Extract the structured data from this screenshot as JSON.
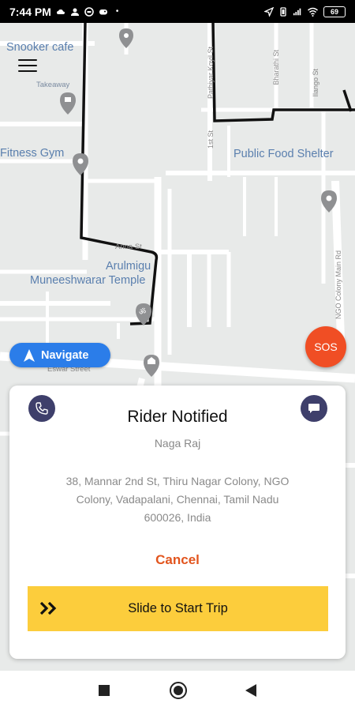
{
  "status_bar": {
    "time": "7:44 PM",
    "battery": "69",
    "icons": [
      "cloud-icon",
      "user-icon",
      "headset-icon",
      "dot"
    ],
    "right_icons": [
      "location-arrow-icon",
      "vibrate-icon",
      "signal-icon",
      "wifi-icon",
      "battery-icon"
    ]
  },
  "map": {
    "labels": {
      "snooker": "Snooker cafe",
      "takeaway": "Takeaway",
      "fitness": "Fitness Gym",
      "food_shelter": "Public Food Shelter",
      "temple_line1": "Arulmigu",
      "temple_line2": "Muneeshwarar Temple",
      "annai_st": "Anna St",
      "eswar_street": "Eswar Street",
      "palaiya_st": "Pathiyar Koyil St",
      "first_st": "1st St",
      "bharathi_st": "Bharathi St",
      "ilango_st": "Ilango St",
      "ngo_main": "NGO Colony Main Rd"
    }
  },
  "navigate": {
    "label": "Navigate",
    "icon": "navigation-arrow-icon"
  },
  "sos": {
    "label": "SOS"
  },
  "card": {
    "title": "Rider Notified",
    "rider_name": "Naga Raj",
    "address": "38, Mannar 2nd St, Thiru Nagar Colony, NGO Colony, Vadapalani, Chennai, Tamil Nadu 600026, India",
    "cancel_label": "Cancel",
    "slide_label": "Slide to Start Trip"
  },
  "colors": {
    "accent_navy": "#3e3f6b",
    "slide_yellow": "#fccd3c",
    "cancel_orange": "#e2551e",
    "sos_red": "#f04e24",
    "navigate_blue": "#2b7de9"
  },
  "nav_bar": {
    "icons": [
      "recents-square-icon",
      "home-circle-icon",
      "back-triangle-icon"
    ]
  }
}
